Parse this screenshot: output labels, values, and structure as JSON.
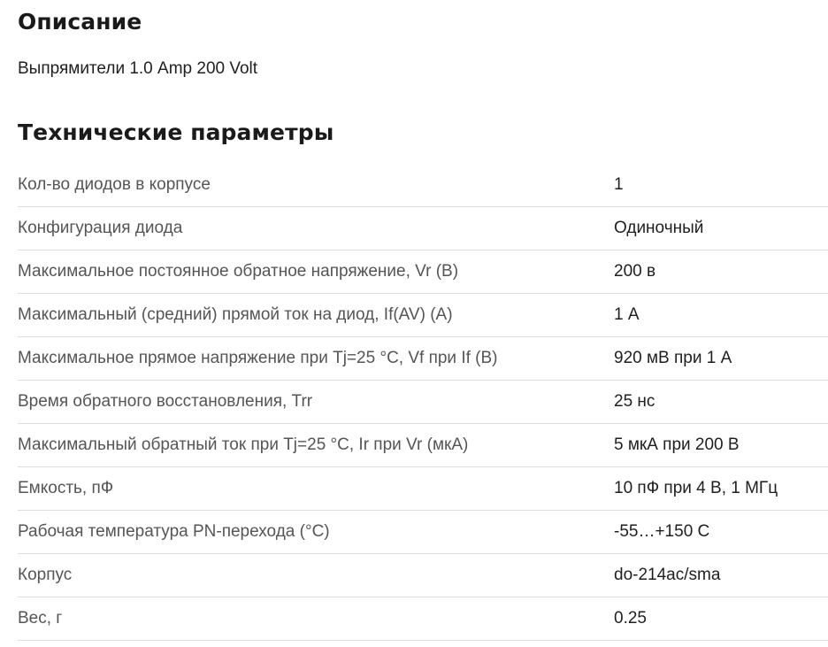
{
  "description": {
    "title": "Описание",
    "text": "Выпрямители 1.0 Amp 200 Volt"
  },
  "specs": {
    "title": "Технические параметры",
    "rows": [
      {
        "name": "Кол-во диодов в корпусе",
        "value": "1"
      },
      {
        "name": "Конфигурация диода",
        "value": "Одиночный"
      },
      {
        "name": "Максимальное постоянное обратное напряжение, Vr (В)",
        "value": "200 в"
      },
      {
        "name": "Максимальный (средний) прямой ток на диод, If(AV) (А)",
        "value": "1 А"
      },
      {
        "name": "Максимальное прямое напряжение при Tj=25 °C, Vf при If (В)",
        "value": "920 мВ при 1 А"
      },
      {
        "name": "Время обратного восстановления, Trr",
        "value": "25 нс"
      },
      {
        "name": "Максимальный обратный ток при Tj=25 °C, Ir при Vr (мкА)",
        "value": "5 мкА при 200 В"
      },
      {
        "name": "Емкость, пФ",
        "value": "10 пФ при 4 В, 1 МГц"
      },
      {
        "name": "Рабочая температура PN-перехода (°C)",
        "value": "-55…+150 C"
      },
      {
        "name": "Корпус",
        "value": "do-214ac/sma"
      },
      {
        "name": "Вес, г",
        "value": "0.25"
      }
    ]
  }
}
